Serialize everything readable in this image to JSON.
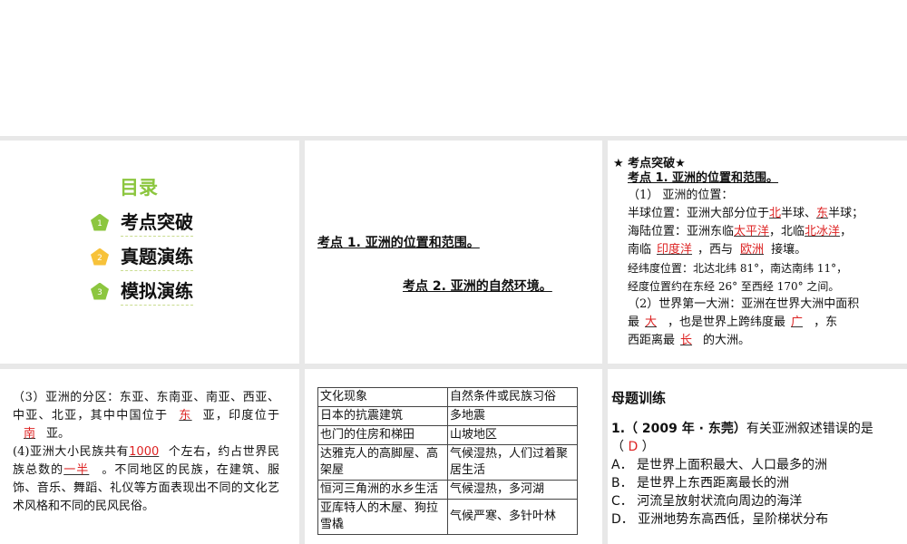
{
  "toc": {
    "title": "目录",
    "items": [
      {
        "num": "1",
        "label": "考点突破",
        "color": "#8cc63f"
      },
      {
        "num": "2",
        "label": "真题演练",
        "color": "#f7c23a"
      },
      {
        "num": "3",
        "label": "模拟演练",
        "color": "#8cc63f"
      }
    ]
  },
  "panel2": {
    "kp1": "考点 1. 亚洲的位置和范围。",
    "kp2": "考点 2. 亚洲的自然环境。"
  },
  "panel3": {
    "header": "★ 考点突破★",
    "title": "考点 1. 亚洲的位置和范围。",
    "l1": "（1）  亚洲的位置：",
    "l2a": "半球位置：亚洲大部分位于",
    "b1": "北",
    "l2b": "半球、",
    "b2": "东",
    "l2c": "半球；",
    "l3a": "海陆位置：亚洲东临",
    "b3": "太平洋",
    "l3b": "，北临",
    "b4": "北冰洋",
    "l3c": "，",
    "l4a": "南临",
    "b5": "印度洋",
    "l4b": "，西与",
    "b6": "欧洲",
    "l4c": "接壤。",
    "l5": "经纬度位置：北达北纬 81°，南达南纬 11°，",
    "l6": "经度位置约在东经 26° 至西经 170° 之间。",
    "l7": "（2）世界第一大洲：亚洲在世界大洲中面积",
    "l8a": "最",
    "b7": "大",
    "l8b": "，也是世界上跨纬度最",
    "b8": "广",
    "l8c": "，东",
    "l9a": "西距离最",
    "b9": "长",
    "l9b": "的大洲。"
  },
  "panel4": {
    "p1a": "（3）亚洲的分区：东亚、东南亚、南亚、西亚、中亚、北亚，其中中国位于",
    "b1": "东",
    "p1b": "亚，印度位于",
    "b2": "南",
    "p1c": "亚。",
    "p2a": "(4)亚洲大小民族共有",
    "b3": "1000",
    "p2b": "个左右，约占世界民族总数的",
    "b4": "一半",
    "p2c": "。不同地区的民族，在建筑、服饰、音乐、舞蹈、礼仪等方面表现出不同的文化艺术风格和不同的民风民俗。"
  },
  "table": {
    "headers": [
      "文化现象",
      "自然条件或民族习俗"
    ],
    "rows": [
      [
        "日本的抗震建筑",
        "多地震"
      ],
      [
        "也门的住房和梯田",
        "山坡地区"
      ],
      [
        "达雅克人的高脚屋、高架屋",
        "气候湿热，人们过着聚居生活"
      ],
      [
        "恒河三角洲的水乡生活",
        "气候湿热，多河湖"
      ],
      [
        "亚库特人的木屋、狗拉雪橇",
        "气候严寒、多针叶林"
      ]
    ]
  },
  "quiz": {
    "title": "母题训练",
    "q": "1.（ 2009 年 · 东莞）",
    "qtext": "有关亚洲叙述错误的是",
    "open": "（ ",
    "answer": "D",
    "close": " ）",
    "options": [
      "A． 是世界上面积最大、人口最多的洲",
      "B． 是世界上东西距离最长的洲",
      "C． 河流呈放射状流向周边的海洋",
      "D． 亚洲地势东高西低，呈阶梯状分布"
    ]
  }
}
